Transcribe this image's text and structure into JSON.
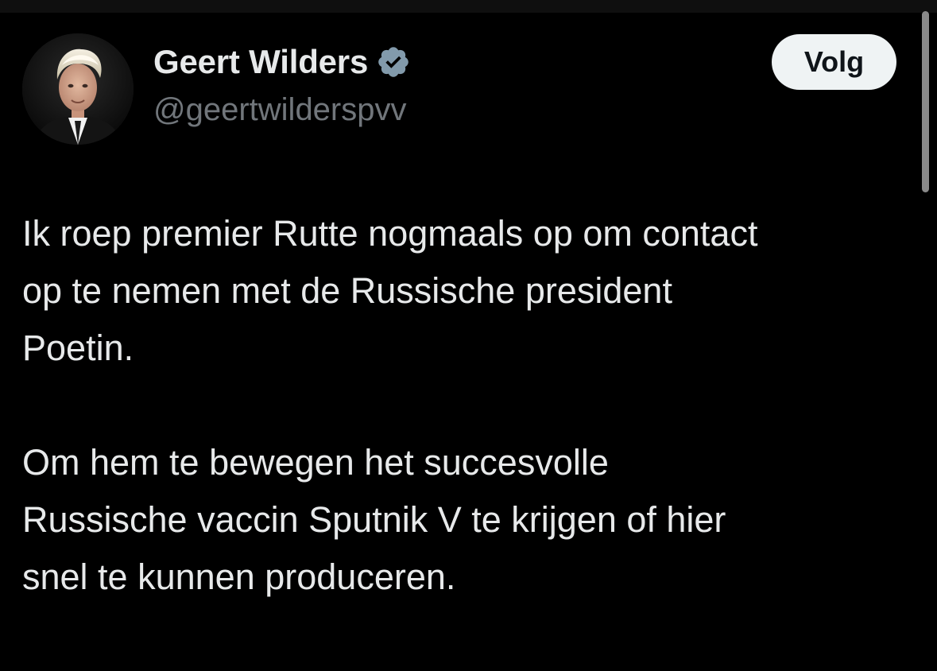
{
  "tweet": {
    "author": {
      "name": "Geert Wilders",
      "handle": "@geertwilderspvv",
      "verified": true,
      "verified_icon": "verified-badge-icon",
      "avatar_icon": "profile-photo"
    },
    "follow_label": "Volg",
    "paragraphs": [
      {
        "lines": [
          "Ik roep premier Rutte nogmaals op om contact",
          "op te nemen met de Russische president",
          "Poetin."
        ]
      },
      {
        "lines": [
          "Om hem te bewegen het succesvolle",
          "Russische vaccin Sputnik V te krijgen of hier",
          "snel te kunnen produceren."
        ]
      }
    ]
  },
  "colors": {
    "background": "#000000",
    "text_primary": "#e7e9ea",
    "text_secondary": "#71767b",
    "verified_badge": "#829aab",
    "follow_button_bg": "#eff3f4",
    "follow_button_text": "#0f1419"
  }
}
